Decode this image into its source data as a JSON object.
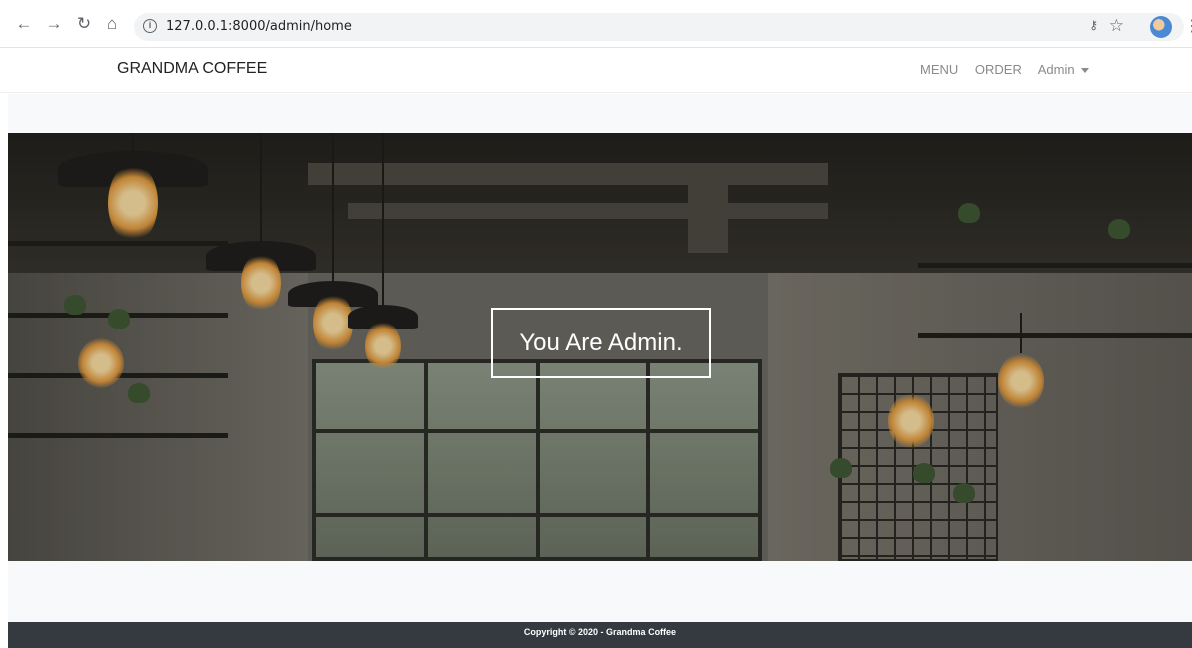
{
  "browser": {
    "url": "127.0.0.1:8000/admin/home",
    "back_icon": "arrow-left-icon",
    "forward_icon": "arrow-right-icon",
    "reload_icon": "reload-icon",
    "home_icon": "home-icon"
  },
  "navbar": {
    "brand": "GRANDMA COFFEE",
    "links": [
      "MENU",
      "ORDER",
      "Admin"
    ]
  },
  "hero": {
    "title": "You Are Admin."
  },
  "footer": {
    "text": "Copyright © 2020 - Grandma Coffee",
    "background": "#343a40"
  }
}
